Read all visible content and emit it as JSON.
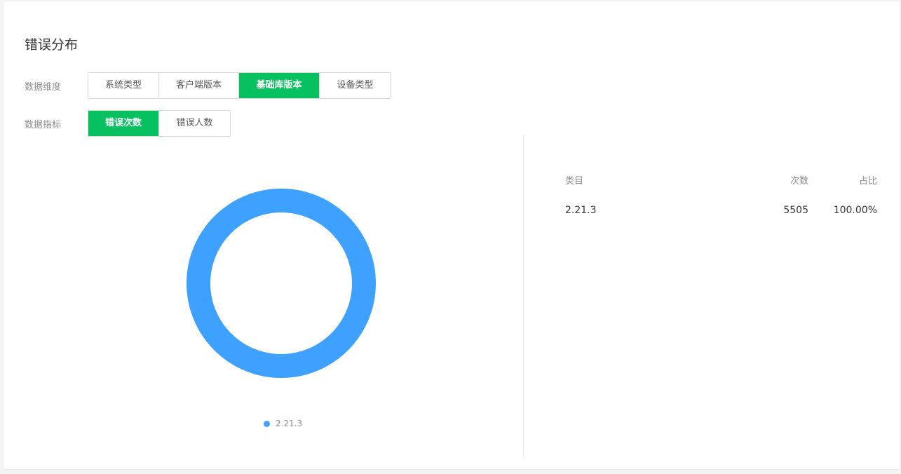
{
  "title": "错误分布",
  "filters": {
    "dimension_label": "数据维度",
    "dimension_options": [
      "系统类型",
      "客户端版本",
      "基础库版本",
      "设备类型"
    ],
    "dimension_selected": "基础库版本",
    "metric_label": "数据指标",
    "metric_options": [
      "错误次数",
      "错误人数"
    ],
    "metric_selected": "错误次数"
  },
  "colors": {
    "accent": "#07c160",
    "series": "#3ea1ff"
  },
  "chart_data": {
    "type": "pie",
    "donut": true,
    "categories": [
      "2.21.3"
    ],
    "values": [
      5505
    ],
    "legend": [
      "2.21.3"
    ],
    "legend_position": "bottom"
  },
  "table": {
    "headers": {
      "category": "类目",
      "count": "次数",
      "ratio": "占比"
    },
    "rows": [
      {
        "category": "2.21.3",
        "count": "5505",
        "ratio": "100.00%"
      }
    ]
  }
}
